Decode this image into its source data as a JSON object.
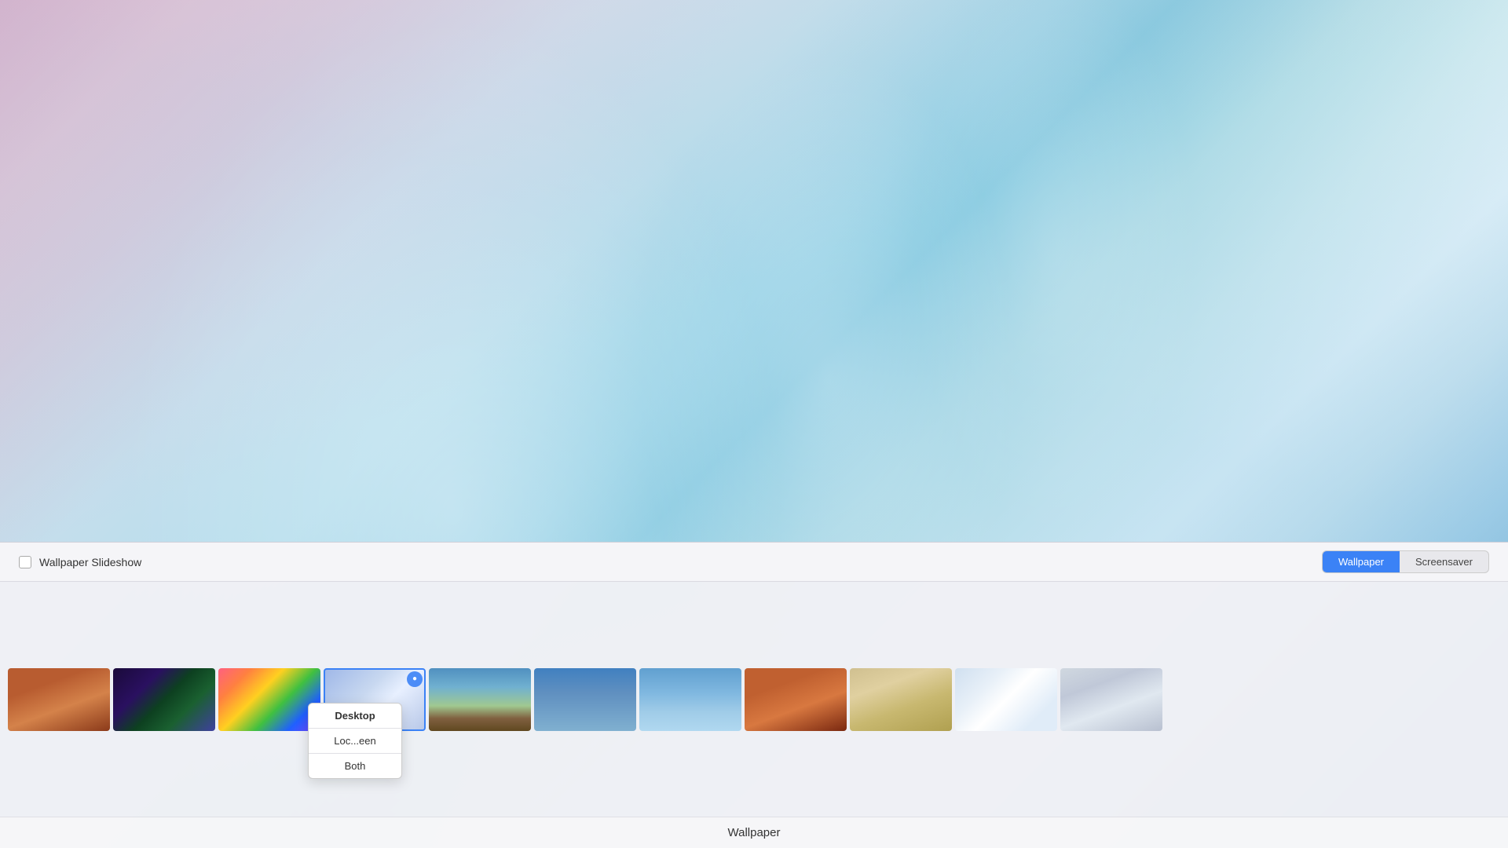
{
  "desktop": {
    "bg_description": "Abstract gradient wallpaper with soft blue, teal, pink, white light beams"
  },
  "panel": {
    "slideshow_label": "Wallpaper Slideshow",
    "wallpaper_tab": "Wallpaper",
    "screensaver_tab": "Screensaver",
    "active_tab": "wallpaper"
  },
  "dropdown": {
    "items": [
      {
        "label": "Desktop",
        "selected": true
      },
      {
        "label": "Loc...een",
        "selected": false
      },
      {
        "label": "Both",
        "selected": false
      }
    ]
  },
  "thumbnails": [
    {
      "id": "thumb-canyon",
      "style": "canyon",
      "selected": false
    },
    {
      "id": "thumb-aurora",
      "style": "aurora",
      "selected": false
    },
    {
      "id": "thumb-rainbow",
      "style": "rainbow",
      "selected": false
    },
    {
      "id": "thumb-gradient",
      "style": "selected",
      "selected": true
    },
    {
      "id": "thumb-mountain",
      "style": "mountain",
      "selected": false
    },
    {
      "id": "thumb-whale",
      "style": "whale",
      "selected": false
    },
    {
      "id": "thumb-fish",
      "style": "fish",
      "selected": false
    },
    {
      "id": "thumb-canyon2",
      "style": "canyon2",
      "selected": false
    },
    {
      "id": "thumb-dunes",
      "style": "dunes",
      "selected": false
    },
    {
      "id": "thumb-light",
      "style": "light",
      "selected": false
    },
    {
      "id": "thumb-bird",
      "style": "bird",
      "selected": false
    }
  ]
}
